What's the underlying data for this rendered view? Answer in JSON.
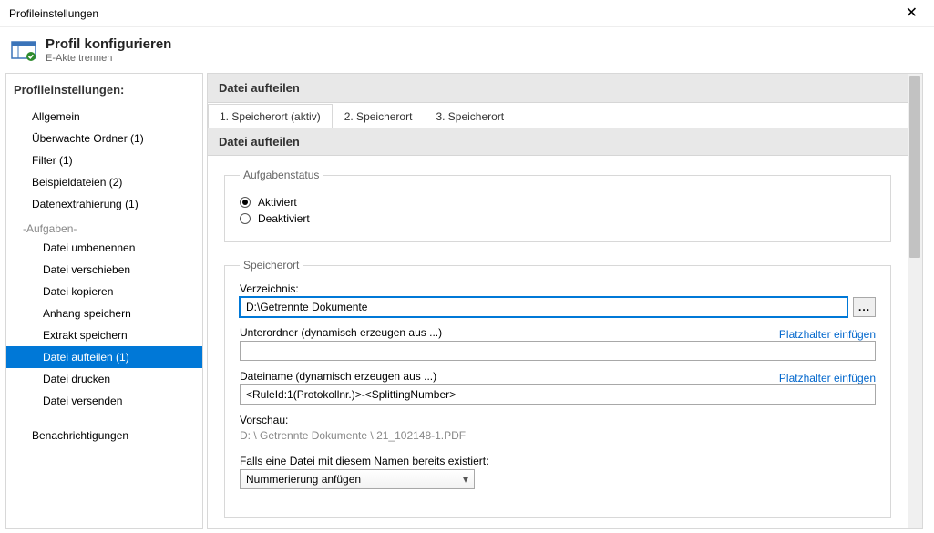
{
  "window": {
    "title": "Profileinstellungen"
  },
  "header": {
    "title": "Profil konfigurieren",
    "subtitle": "E-Akte trennen"
  },
  "sidebar": {
    "heading": "Profileinstellungen:",
    "items": [
      {
        "label": "Allgemein"
      },
      {
        "label": "Überwachte Ordner (1)"
      },
      {
        "label": "Filter (1)"
      },
      {
        "label": "Beispieldateien (2)"
      },
      {
        "label": "Datenextrahierung (1)"
      }
    ],
    "tasks_label": "-Aufgaben-",
    "tasks": [
      {
        "label": "Datei umbenennen"
      },
      {
        "label": "Datei verschieben"
      },
      {
        "label": "Datei kopieren"
      },
      {
        "label": "Anhang speichern"
      },
      {
        "label": "Extrakt speichern"
      },
      {
        "label": "Datei aufteilen (1)",
        "selected": true
      },
      {
        "label": "Datei drucken"
      },
      {
        "label": "Datei versenden"
      }
    ],
    "footer_item": "Benachrichtigungen"
  },
  "main": {
    "section_title": "Datei aufteilen",
    "tabs": [
      {
        "label": "1. Speicherort (aktiv)",
        "active": true
      },
      {
        "label": "2. Speicherort"
      },
      {
        "label": "3. Speicherort"
      }
    ],
    "subheader": "Datei aufteilen",
    "status_group": {
      "legend": "Aufgabenstatus",
      "active_label": "Aktiviert",
      "inactive_label": "Deaktiviert"
    },
    "location_group": {
      "legend": "Speicherort",
      "dir_label": "Verzeichnis:",
      "dir_value": "D:\\Getrennte Dokumente",
      "browse_label": "...",
      "subfolder_label": "Unterordner (dynamisch erzeugen aus ...)",
      "subfolder_value": "",
      "placeholder_link": "Platzhalter einfügen",
      "filename_label": "Dateiname (dynamisch erzeugen aus ...)",
      "filename_value": "<RuleId:1(Protokollnr.)>-<SplittingNumber>",
      "preview_label": "Vorschau:",
      "preview_value": "D: \\ Getrennte Dokumente \\ 21_102148-1.PDF",
      "exists_label": "Falls eine Datei mit diesem Namen bereits existiert:",
      "exists_value": "Nummerierung anfügen"
    }
  }
}
